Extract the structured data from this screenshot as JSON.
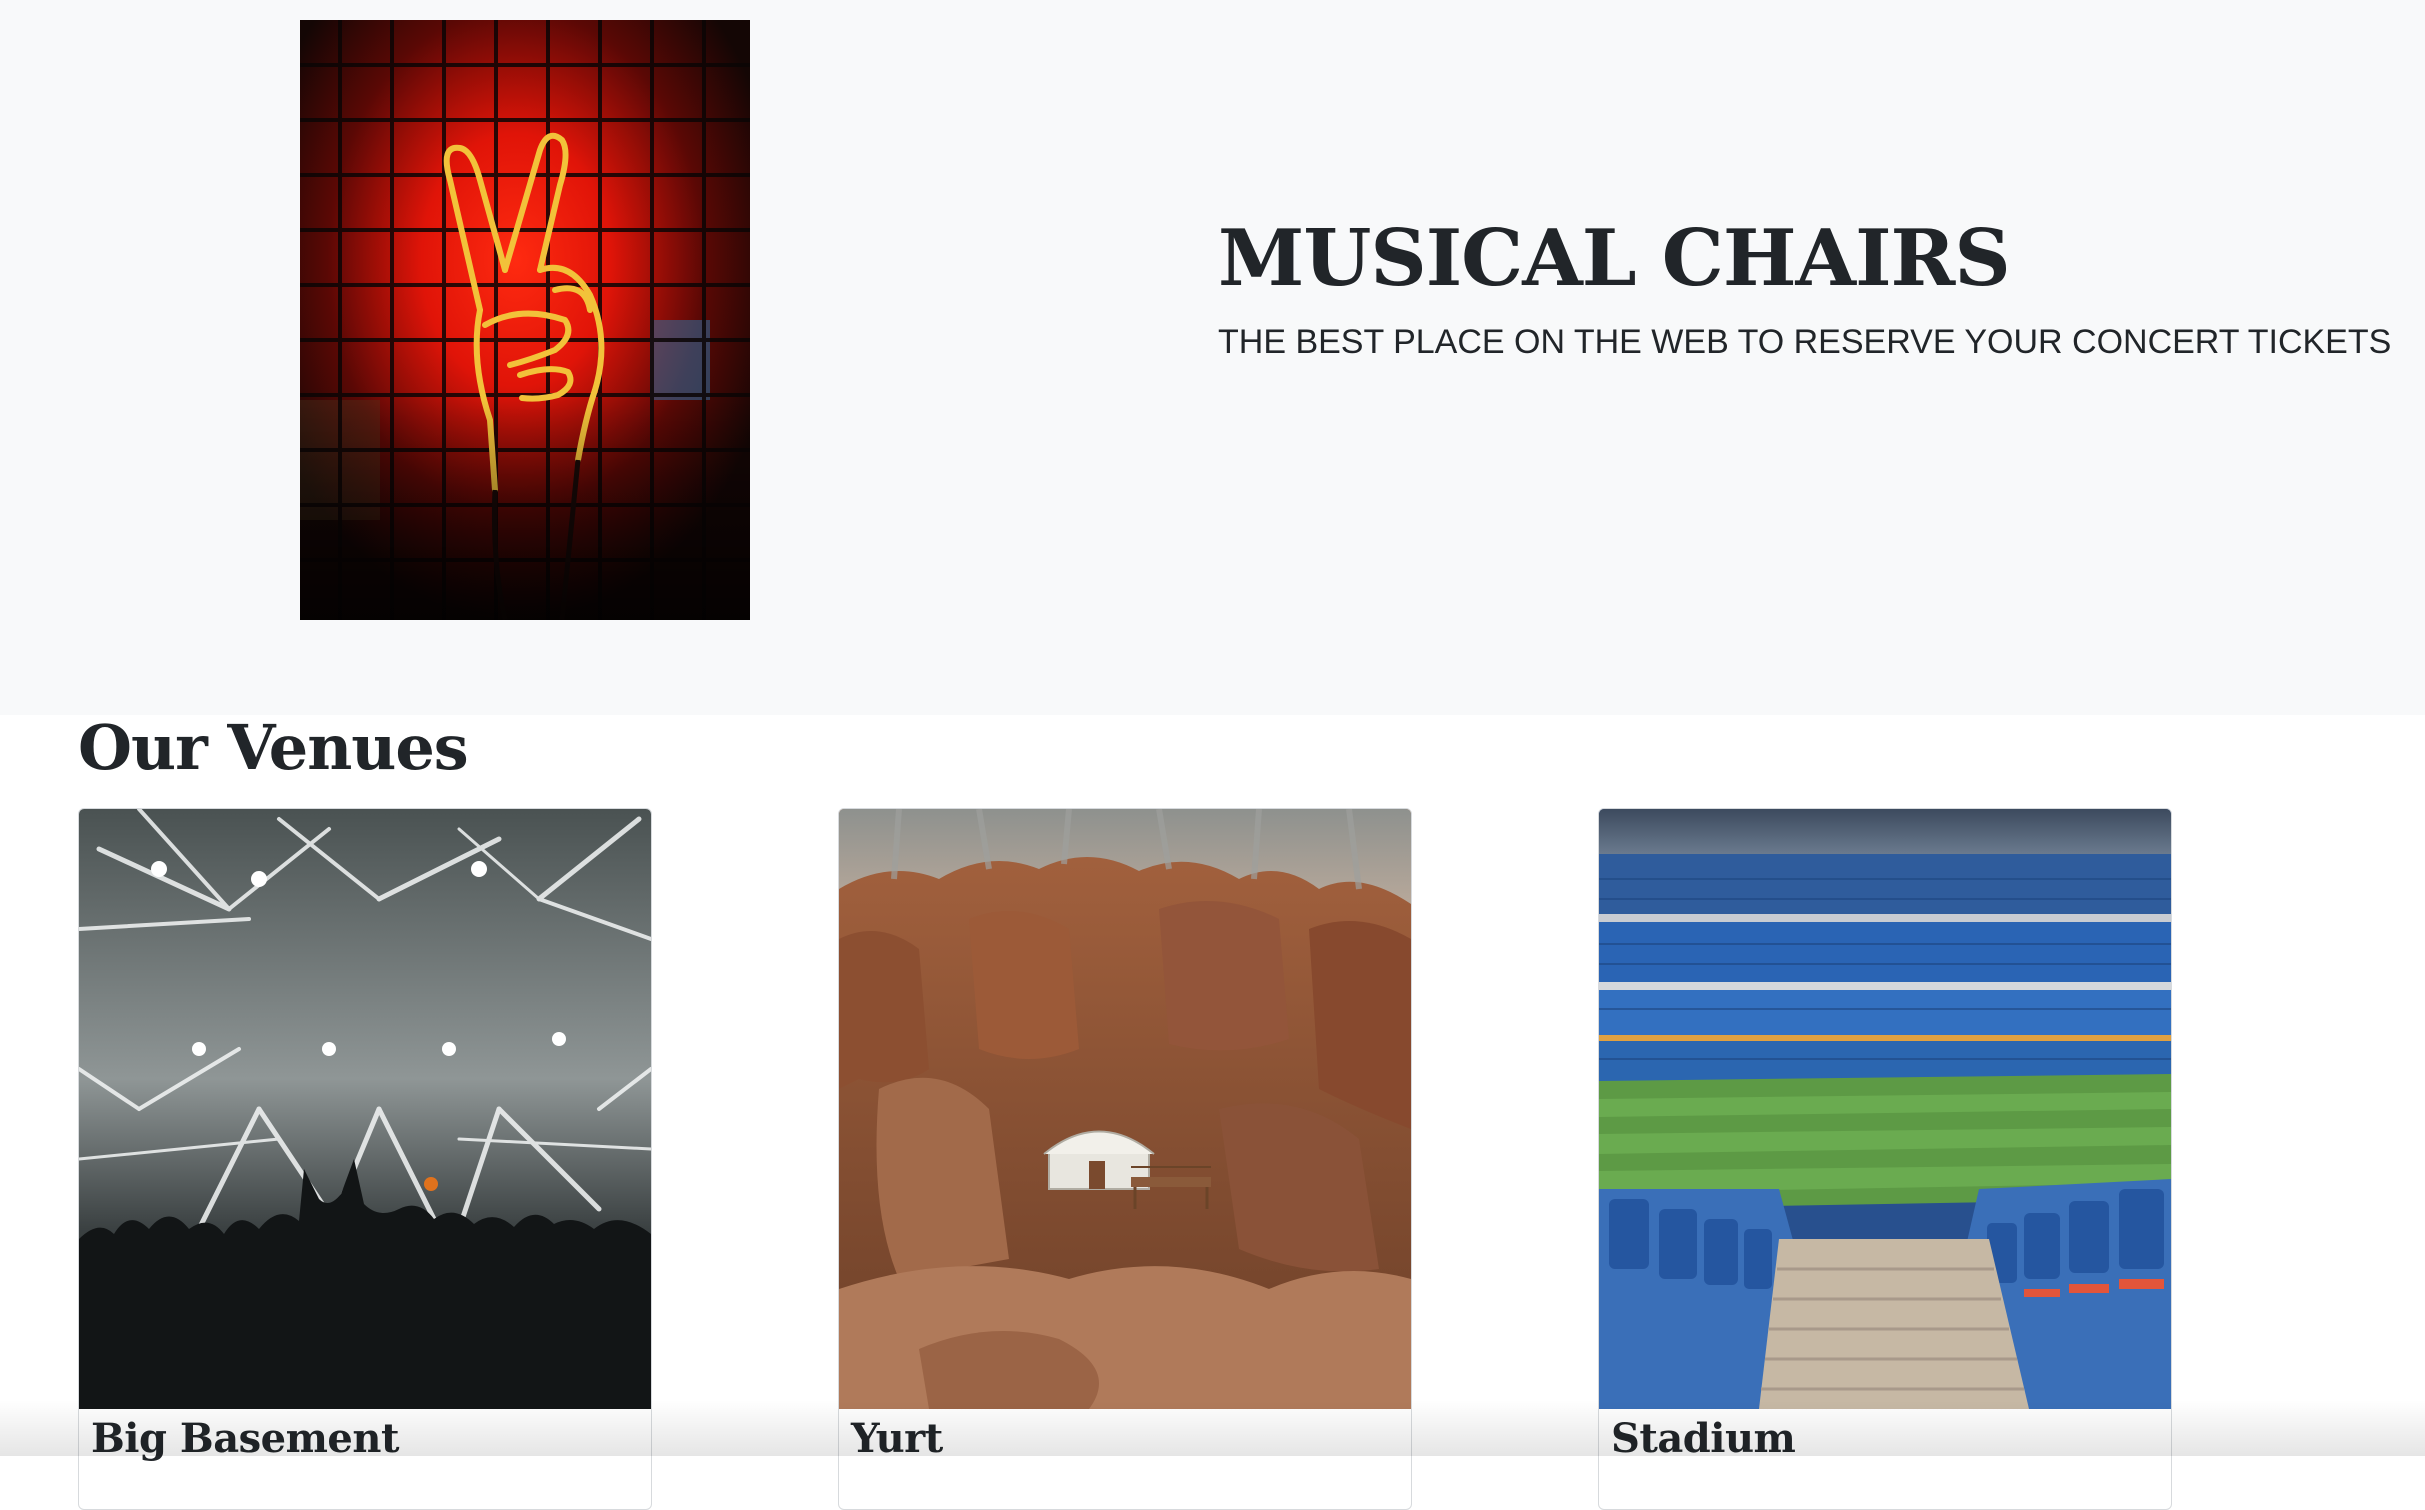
{
  "hero": {
    "title": "MUSICAL CHAIRS",
    "tagline": "THE BEST PLACE ON THE WEB TO RESERVE YOUR CONCERT TICKETS",
    "poster": {
      "subject": "neon-peace-sign-hand"
    }
  },
  "venues": {
    "heading": "Our Venues",
    "items": [
      {
        "name": "Big Basement",
        "photo": "concert-crowd-lights"
      },
      {
        "name": "Yurt",
        "photo": "yurt-in-canyon"
      },
      {
        "name": "Stadium",
        "photo": "football-stadium"
      }
    ]
  },
  "colors": {
    "hero_background": "#f8f9fa",
    "text": "#212529",
    "neon_red": "#e01408",
    "neon_yellow": "#f2c23a",
    "stadium_seat_blue": "#2a64b4",
    "pitch_green": "#5d9a45"
  }
}
